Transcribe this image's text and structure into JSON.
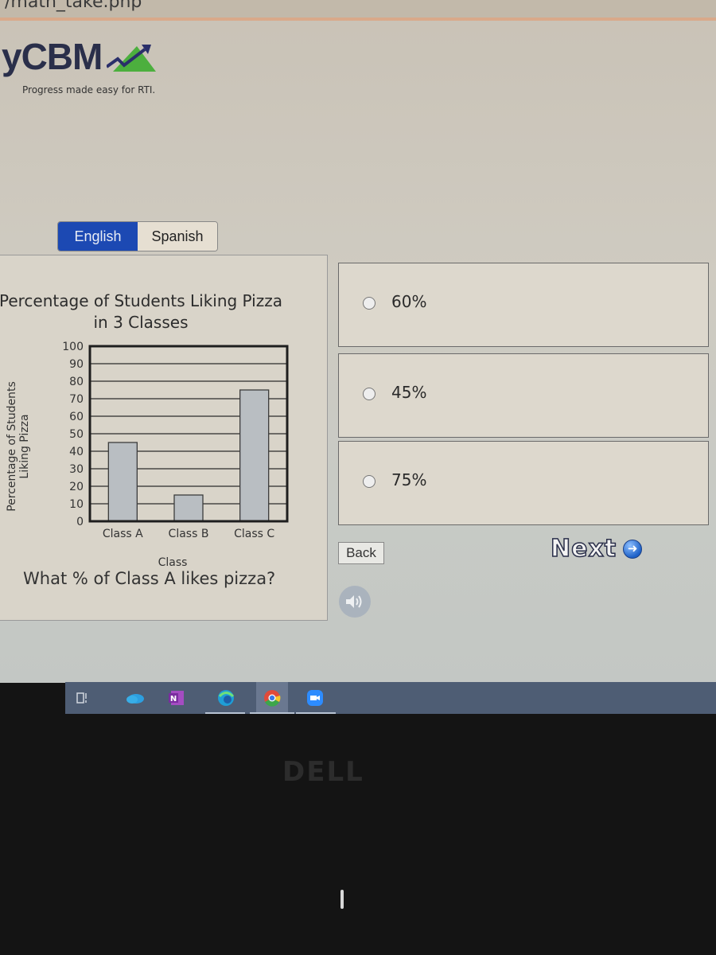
{
  "browser": {
    "url_fragment": "/math_take.php"
  },
  "brand": {
    "logo_text": "yCBM",
    "tagline": "Progress made easy for RTI.",
    "colors": {
      "logo_text": "#2a2f4a",
      "logo_triangle": "#4caf3e",
      "logo_arrow": "#2a2f6a"
    }
  },
  "language_toggle": {
    "options": [
      {
        "label": "English",
        "selected": true
      },
      {
        "label": "Spanish",
        "selected": false
      }
    ],
    "active_color": "#1c49b3"
  },
  "question": {
    "prompt": "What % of Class A likes pizza?"
  },
  "chart_data": {
    "type": "bar",
    "title": "Percentage of Students Liking Pizza in 3 Classes",
    "title_lines": [
      "Percentage of Students Liking Pizza",
      "in 3 Classes"
    ],
    "xlabel": "Class",
    "ylabel_lines": [
      "Percentage of Students",
      "Liking Pizza"
    ],
    "categories": [
      "Class A",
      "Class B",
      "Class C"
    ],
    "values": [
      45,
      15,
      75
    ],
    "ylim": [
      0,
      100
    ],
    "yticks": [
      0,
      10,
      20,
      30,
      40,
      50,
      60,
      70,
      80,
      90,
      100
    ],
    "grid": true,
    "bar_color": "#b9bec2"
  },
  "answers": [
    {
      "label": "60%",
      "selected": false
    },
    {
      "label": "45%",
      "selected": false
    },
    {
      "label": "75%",
      "selected": false
    }
  ],
  "navigation": {
    "back_label": "Back",
    "next_label": "Next"
  },
  "taskbar": {
    "icons": [
      "task-view-icon",
      "onedrive-icon",
      "onenote-icon",
      "edge-icon",
      "chrome-icon",
      "zoom-icon"
    ]
  },
  "device": {
    "brand": "DELL"
  }
}
